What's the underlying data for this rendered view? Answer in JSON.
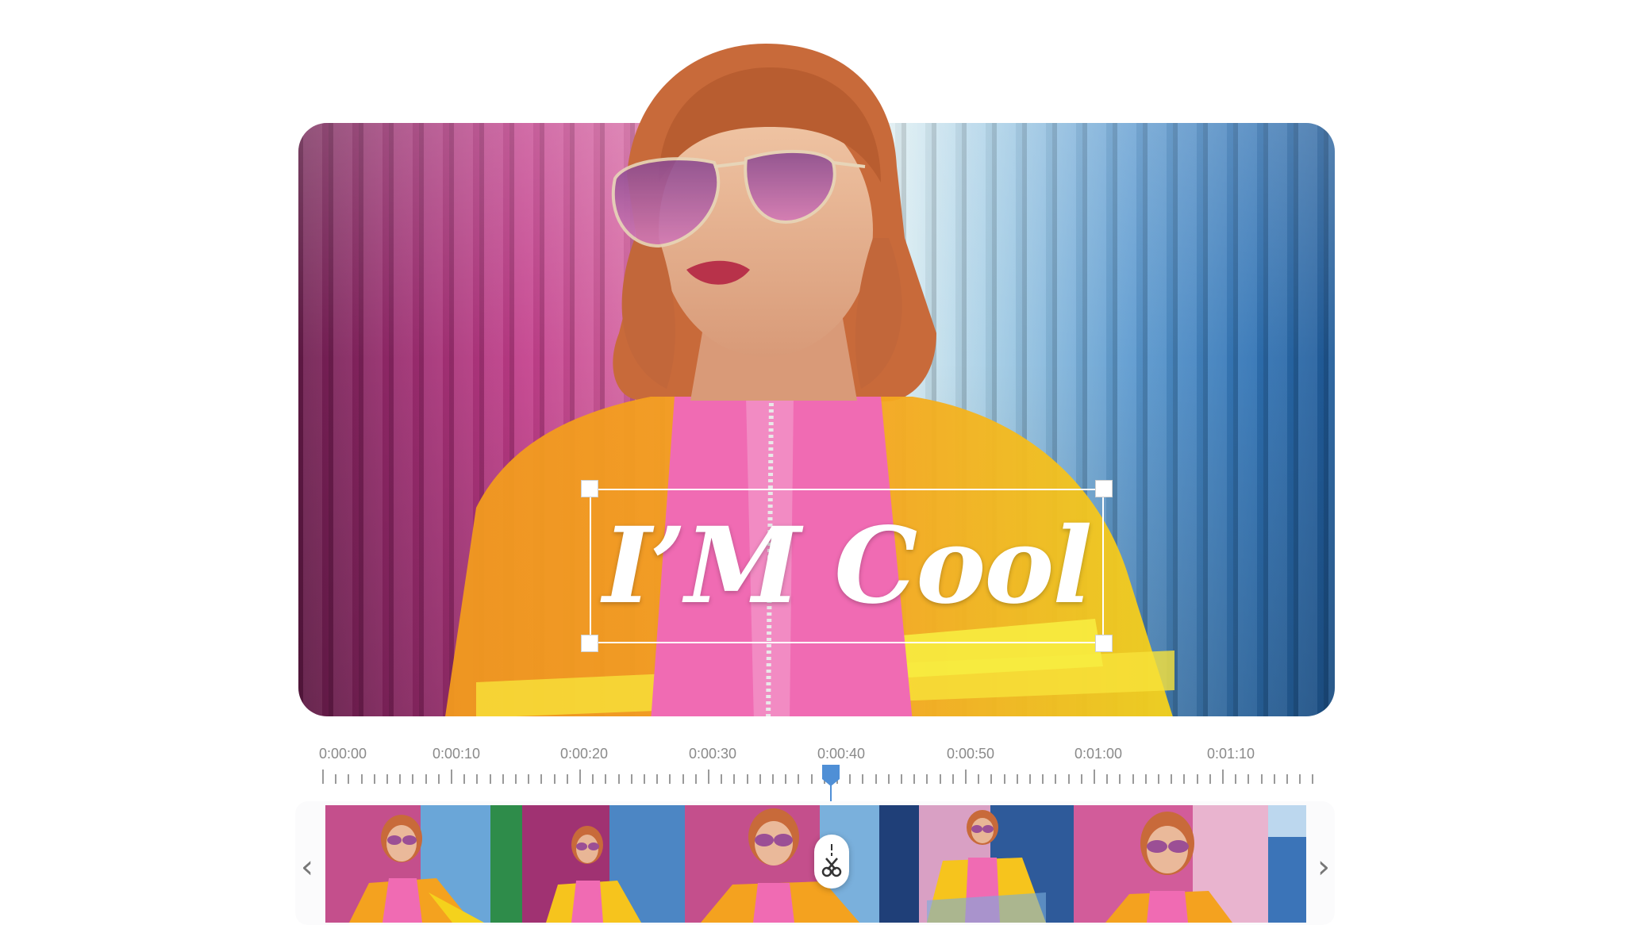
{
  "preview": {
    "overlay_text": "I’M Cool"
  },
  "timeline": {
    "labels": [
      "0:00:00",
      "0:00:10",
      "0:00:20",
      "0:00:30",
      "0:00:40",
      "0:00:50",
      "0:01:00",
      "0:01:10"
    ],
    "playhead": "0:00:40"
  },
  "filmstrip": {
    "prev_icon": "chevron-left-icon",
    "next_icon": "chevron-right-icon",
    "split_icon": "scissors-icon"
  },
  "colors": {
    "accent": "#4f8fd6",
    "jacket_orange": "#f39a1f",
    "jacket_yellow": "#f4d21c",
    "top_pink": "#f06bb3",
    "hair": "#c86a3a"
  }
}
